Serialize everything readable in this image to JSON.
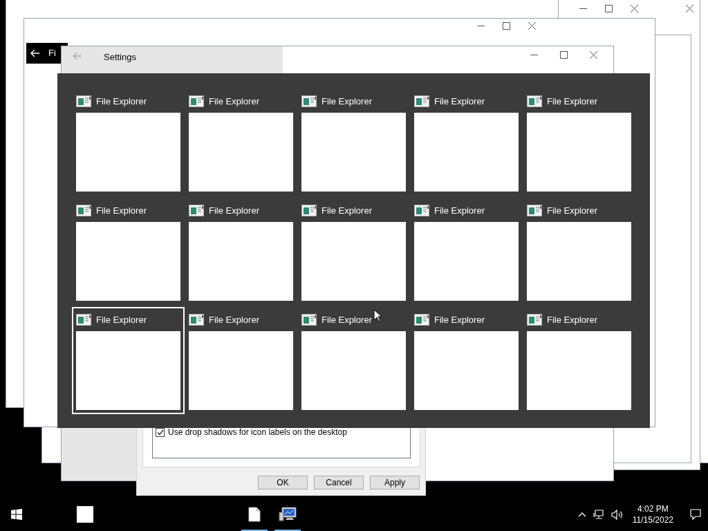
{
  "back_window": {
    "title": "Fi"
  },
  "settings_window": {
    "title": "Settings"
  },
  "performance_dialog": {
    "options": [
      {
        "label": "Use drop shadows for icon labels on the desktop",
        "checked": true
      }
    ],
    "buttons": [
      {
        "label": "OK"
      },
      {
        "label": "Cancel"
      },
      {
        "label": "Apply"
      }
    ]
  },
  "task_switcher": {
    "items": [
      {
        "title": "File Explorer",
        "selected": false
      },
      {
        "title": "File Explorer",
        "selected": false
      },
      {
        "title": "File Explorer",
        "selected": false
      },
      {
        "title": "File Explorer",
        "selected": false
      },
      {
        "title": "File Explorer",
        "selected": false
      },
      {
        "title": "File Explorer",
        "selected": false
      },
      {
        "title": "File Explorer",
        "selected": false
      },
      {
        "title": "File Explorer",
        "selected": false
      },
      {
        "title": "File Explorer",
        "selected": false
      },
      {
        "title": "File Explorer",
        "selected": false
      },
      {
        "title": "File Explorer",
        "selected": true
      },
      {
        "title": "File Explorer",
        "selected": false
      },
      {
        "title": "File Explorer",
        "selected": false
      },
      {
        "title": "File Explorer",
        "selected": false
      },
      {
        "title": "File Explorer",
        "selected": false
      }
    ]
  },
  "taskbar": {
    "apps": [
      {
        "kind": "blank",
        "running": false
      },
      {
        "kind": "document",
        "running": true
      },
      {
        "kind": "computer",
        "running": true
      }
    ],
    "clock": {
      "time": "4:02 PM",
      "date": "11/15/2022"
    }
  }
}
